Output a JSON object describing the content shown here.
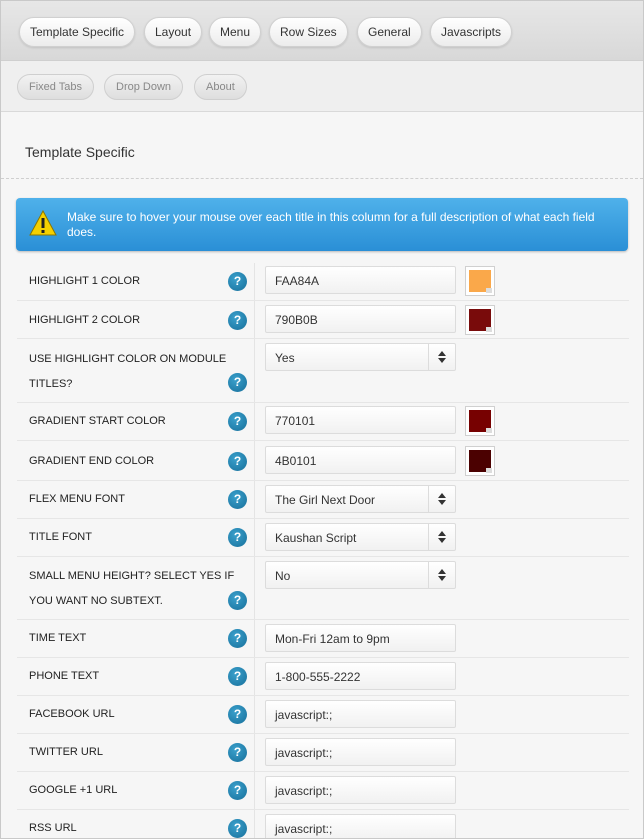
{
  "primary_tabs": [
    "Template Specific",
    "Layout",
    "Menu",
    "Row Sizes",
    "General",
    "Javascripts"
  ],
  "secondary_tabs": [
    "Fixed Tabs",
    "Drop Down",
    "About"
  ],
  "section_title": "Template Specific",
  "notice": "Make sure to hover your mouse over each title in this column for a full description of what each field does.",
  "help_glyph": "?",
  "fields": {
    "highlight1": {
      "label": "HIGHLIGHT 1 COLOR",
      "value": "FAA84A",
      "color": "#FAA84A"
    },
    "highlight2": {
      "label": "HIGHLIGHT 2 COLOR",
      "value": "790B0B",
      "color": "#790B0B"
    },
    "use_highlight": {
      "label": "USE HIGHLIGHT COLOR ON MODULE TITLES?",
      "value": "Yes"
    },
    "grad_start": {
      "label": "GRADIENT START COLOR",
      "value": "770101",
      "color": "#770101"
    },
    "grad_end": {
      "label": "GRADIENT END COLOR",
      "value": "4B0101",
      "color": "#4B0101"
    },
    "flex_font": {
      "label": "FLEX MENU FONT",
      "value": "The Girl Next Door"
    },
    "title_font": {
      "label": "TITLE FONT",
      "value": "Kaushan Script"
    },
    "small_menu": {
      "label": "SMALL MENU HEIGHT? SELECT YES IF YOU WANT NO SUBTEXT.",
      "value": "No"
    },
    "time_text": {
      "label": "TIME TEXT",
      "value": "Mon-Fri 12am to 9pm"
    },
    "phone_text": {
      "label": "PHONE TEXT",
      "value": "1-800-555-2222"
    },
    "facebook": {
      "label": "FACEBOOK URL",
      "value": "javascript:;"
    },
    "twitter": {
      "label": "TWITTER URL",
      "value": "javascript:;"
    },
    "google": {
      "label": "GOOGLE +1 URL",
      "value": "javascript:;"
    },
    "rss": {
      "label": "RSS URL",
      "value": "javascript:;"
    }
  }
}
